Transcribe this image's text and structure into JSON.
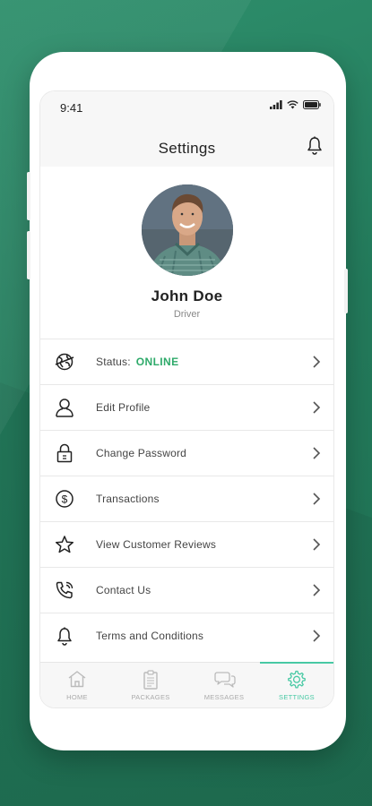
{
  "status_bar": {
    "time": "9:41"
  },
  "header": {
    "title": "Settings"
  },
  "profile": {
    "name": "John Doe",
    "role": "Driver"
  },
  "menu": {
    "status": {
      "label": "Status:",
      "value": "ONLINE"
    },
    "items": [
      {
        "label": "Edit Profile"
      },
      {
        "label": "Change Password"
      },
      {
        "label": "Transactions"
      },
      {
        "label": "View Customer Reviews"
      },
      {
        "label": "Contact Us"
      },
      {
        "label": "Terms and Conditions"
      }
    ]
  },
  "tabs": [
    {
      "label": "HOME"
    },
    {
      "label": "PACKAGES"
    },
    {
      "label": "MESSAGES"
    },
    {
      "label": "SETTINGS",
      "active": true
    }
  ],
  "colors": {
    "accent": "#48c9a4",
    "online": "#2eaa6a",
    "background": "#237a5b"
  }
}
